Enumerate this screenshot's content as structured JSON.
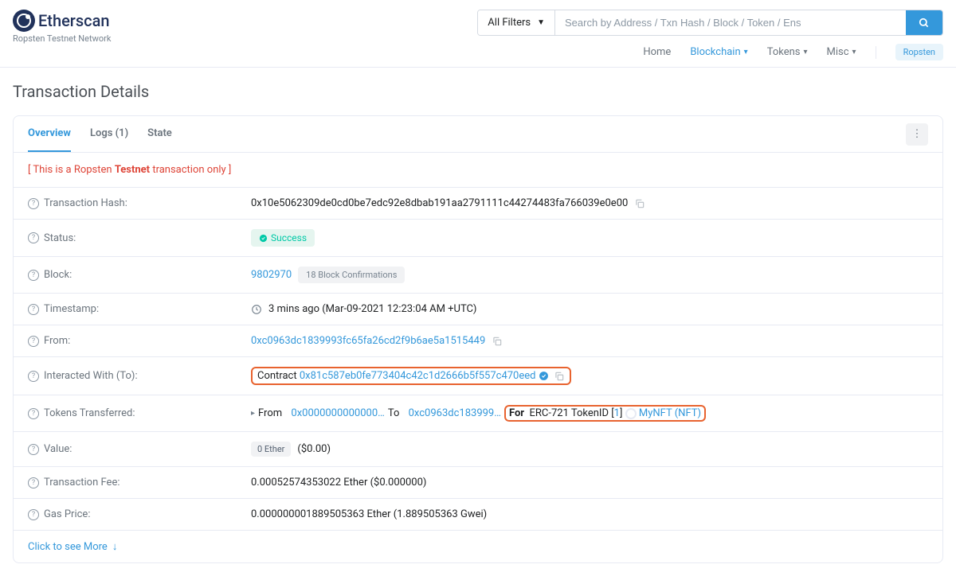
{
  "branding": {
    "name": "Etherscan",
    "subtitle": "Ropsten Testnet Network"
  },
  "search": {
    "filter": "All Filters",
    "placeholder": "Search by Address / Txn Hash / Block / Token / Ens"
  },
  "nav": {
    "home": "Home",
    "blockchain": "Blockchain",
    "tokens": "Tokens",
    "misc": "Misc",
    "badge": "Ropsten"
  },
  "page": {
    "title": "Transaction Details"
  },
  "tabs": {
    "overview": "Overview",
    "logs": "Logs (1)",
    "state": "State"
  },
  "notice": {
    "prefix": "[ This is a Ropsten ",
    "bold": "Testnet",
    "suffix": " transaction only ]"
  },
  "tx": {
    "hash_label": "Transaction Hash:",
    "hash": "0x10e5062309de0cd0be7edc92e8dbab191aa2791111c44274483fa766039e0e00",
    "status_label": "Status:",
    "status": "Success",
    "block_label": "Block:",
    "block": "9802970",
    "confirmations": "18 Block Confirmations",
    "timestamp_label": "Timestamp:",
    "timestamp": "3 mins ago (Mar-09-2021 12:23:04 AM +UTC)",
    "from_label": "From:",
    "from": "0xc0963dc1839993fc65fa26cd2f9b6ae5a1515449",
    "to_label": "Interacted With (To):",
    "to_prefix": "Contract",
    "to": "0x81c587eb0fe773404c42c1d2666b5f557c470eed",
    "transfer_label": "Tokens Transferred:",
    "transfer": {
      "from_label": "From",
      "from": "0x0000000000000…",
      "to_label": "To",
      "to": "0xc0963dc183999…",
      "for_label": "For",
      "type": "ERC-721 TokenID [",
      "token_id": "1",
      "close": "]",
      "token_name": "MyNFT (NFT)"
    },
    "value_label": "Value:",
    "value_badge": "0 Ether",
    "value_usd": "($0.00)",
    "fee_label": "Transaction Fee:",
    "fee": "0.00052574353022 Ether ($0.000000)",
    "gas_label": "Gas Price:",
    "gas": "0.000000001889505363 Ether (1.889505363 Gwei)"
  },
  "show_more": "Click to see More"
}
